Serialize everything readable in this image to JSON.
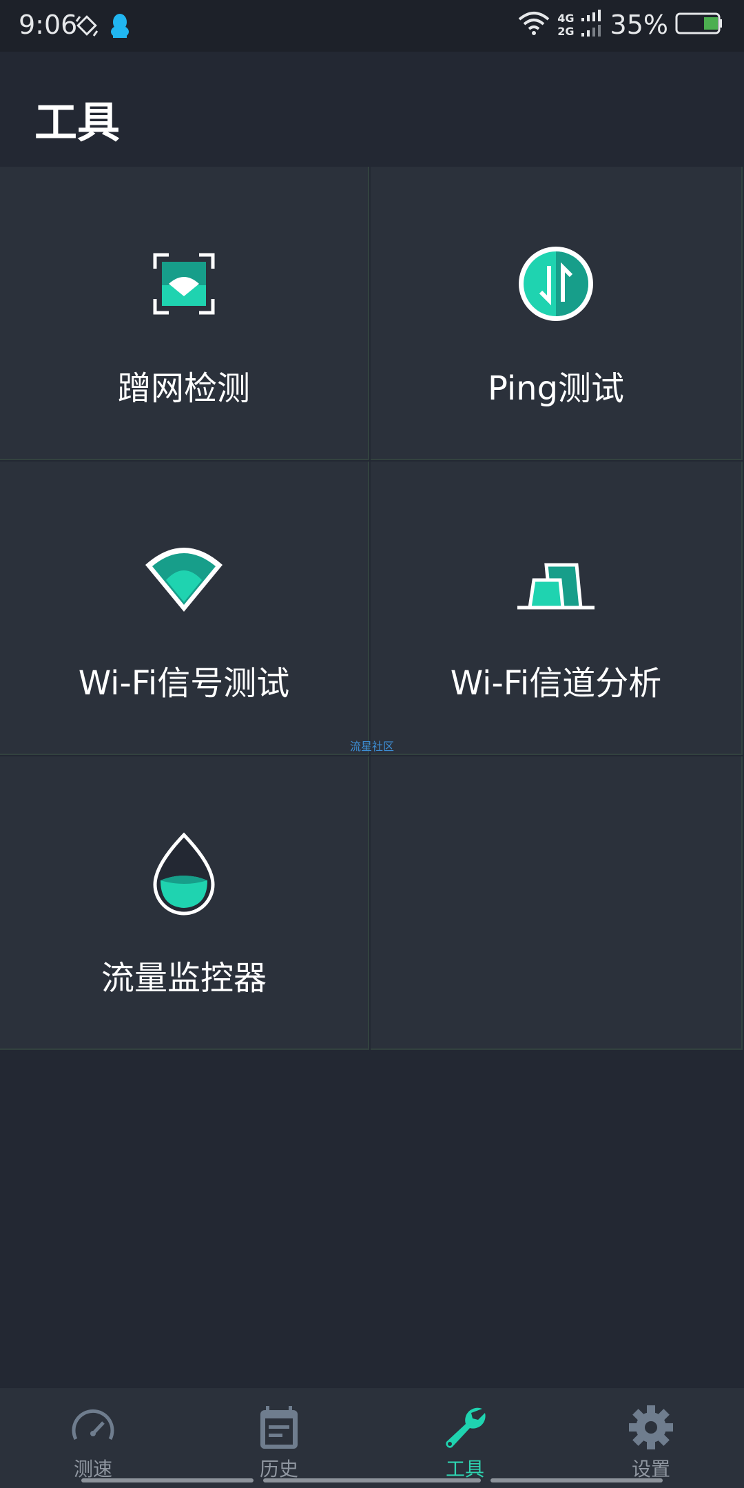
{
  "status_bar": {
    "time": "9:06",
    "net_top": "4G",
    "net_bottom": "2G",
    "battery": "35%",
    "icons": [
      "rotate-icon",
      "qq-icon",
      "wifi-icon",
      "signal-icon",
      "battery-icon"
    ],
    "battery_level": 0.35,
    "battery_color": "#4caf50"
  },
  "header": {
    "title": "工具"
  },
  "tools": [
    {
      "label": "蹭网检测",
      "icon": "scan-wifi-icon"
    },
    {
      "label": "Ping测试",
      "icon": "ping-arrows-icon"
    },
    {
      "label": "Wi-Fi信号测试",
      "icon": "wifi-signal-icon"
    },
    {
      "label": "Wi-Fi信道分析",
      "icon": "channel-bars-icon"
    },
    {
      "label": "流量监控器",
      "icon": "water-drop-icon"
    }
  ],
  "watermark": "流星社区",
  "bottom_nav": {
    "items": [
      {
        "label": "测速",
        "icon": "speedometer-icon"
      },
      {
        "label": "历史",
        "icon": "history-clipboard-icon"
      },
      {
        "label": "工具",
        "icon": "wrench-icon"
      },
      {
        "label": "设置",
        "icon": "gear-icon"
      }
    ],
    "active": "工具"
  },
  "colors": {
    "accent": "#1fd3b0",
    "accent_dark": "#179e8a",
    "background": "#232833",
    "tile": "#2b313b"
  }
}
